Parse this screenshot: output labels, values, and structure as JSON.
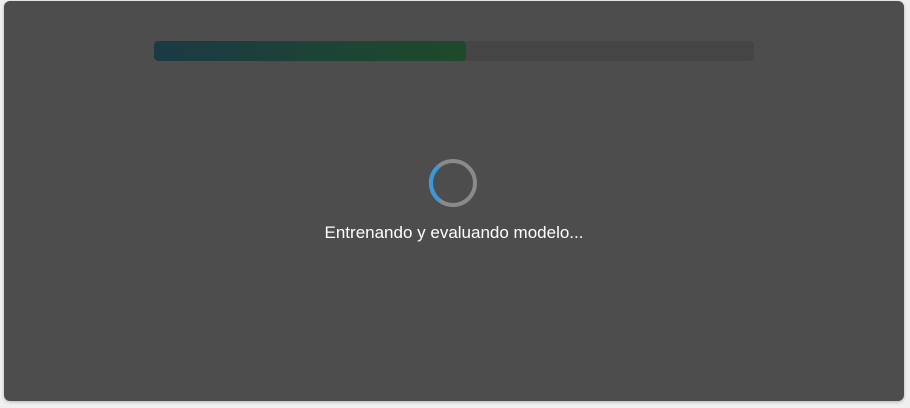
{
  "progress": {
    "fraction": 0.52,
    "fill_colors": [
      "#1b3a44",
      "#1f4a2a"
    ],
    "track_color": "#454545"
  },
  "spinner": {
    "icon": "loading-spinner-icon",
    "ring_color": "#8a8a8a",
    "arc_color": "#3a9ad9"
  },
  "status": {
    "text": "Entrenando y evaluando modelo..."
  },
  "panel": {
    "background": "#4d4d4d"
  }
}
